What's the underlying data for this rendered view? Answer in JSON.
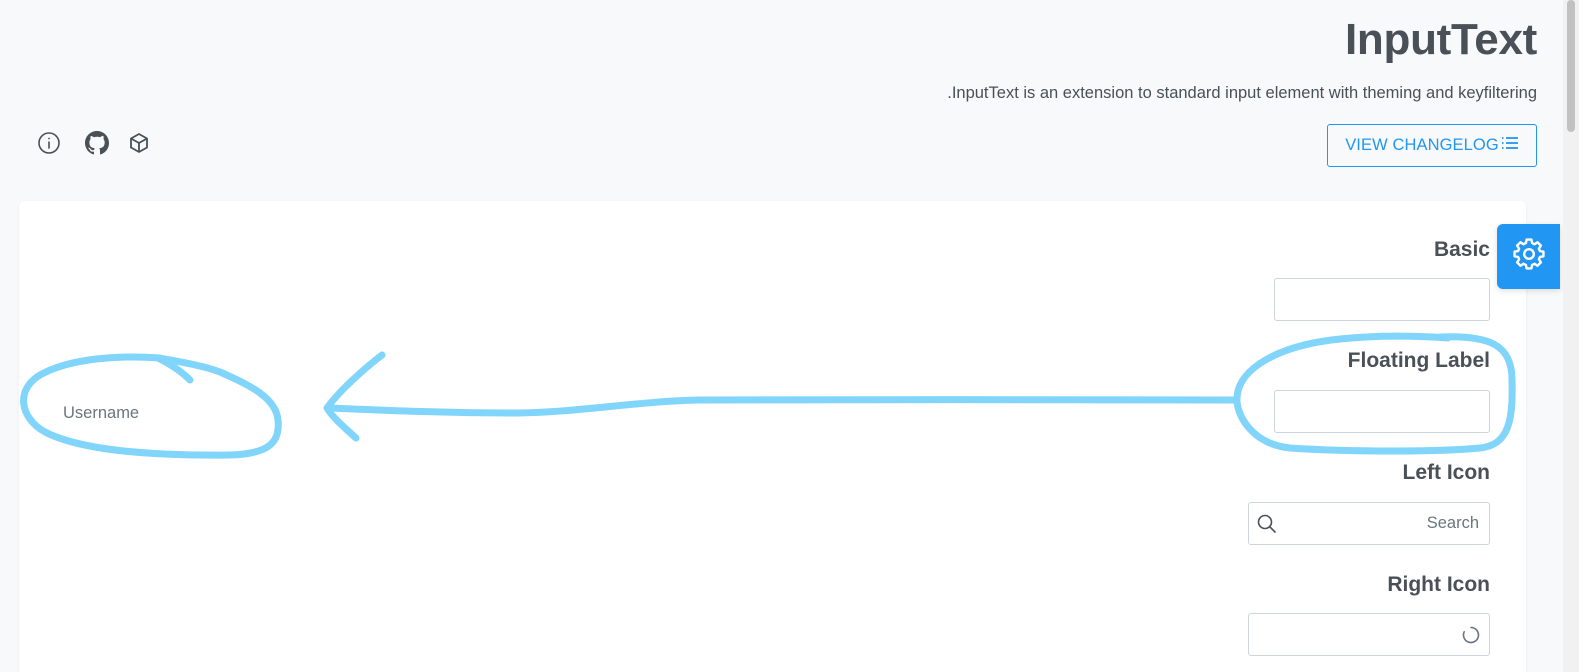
{
  "header": {
    "title": "InputText",
    "description": ".InputText is an extension to standard input element with theming and keyfiltering",
    "changelog_label": "VIEW CHANGELOG",
    "icons": [
      "info-icon",
      "github-icon",
      "box-icon",
      "list-icon"
    ]
  },
  "sections": {
    "basic": {
      "title": "Basic",
      "value": ""
    },
    "floating": {
      "title": "Floating Label",
      "value": "",
      "label": "Username"
    },
    "left_icon": {
      "title": "Left Icon",
      "placeholder": "Search",
      "icon": "search-icon"
    },
    "right_icon": {
      "title": "Right Icon",
      "value": "",
      "icon": "spinner-icon"
    }
  },
  "config": {
    "icon": "gear-icon"
  },
  "colors": {
    "accent": "#2196f3",
    "annotation": "#81d4fa",
    "text": "#495057",
    "page_bg": "#f8f9fa"
  }
}
